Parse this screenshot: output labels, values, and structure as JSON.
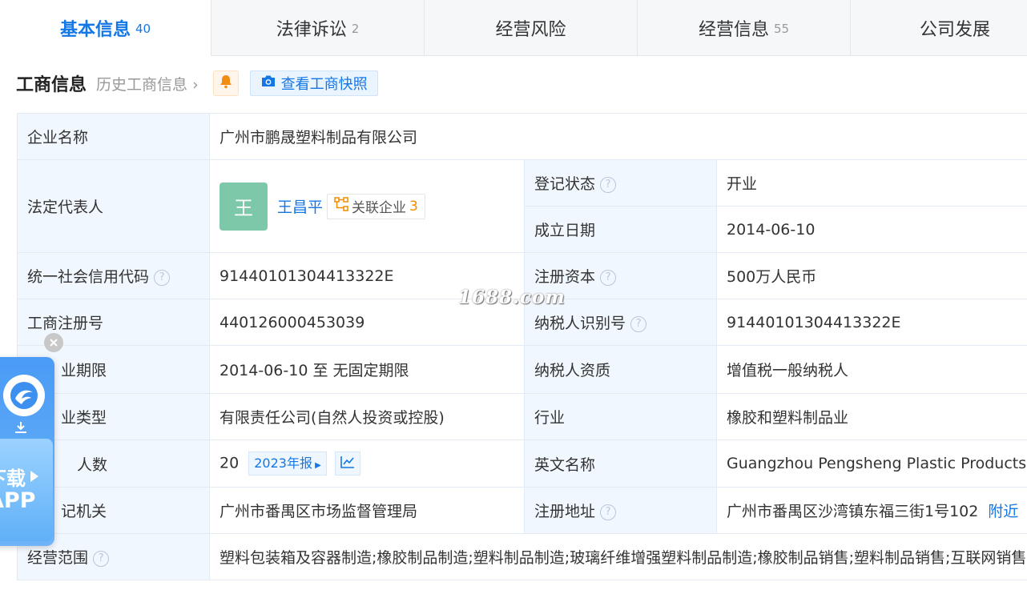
{
  "tabs": [
    {
      "label": "基本信息",
      "count": "40"
    },
    {
      "label": "法律诉讼",
      "count": "2"
    },
    {
      "label": "经营风险",
      "count": ""
    },
    {
      "label": "经营信息",
      "count": "55"
    },
    {
      "label": "公司发展",
      "count": ""
    }
  ],
  "section": {
    "title": "工商信息",
    "history_link": "历史工商信息",
    "snapshot_label": "查看工商快照"
  },
  "info": {
    "company_name_label": "企业名称",
    "company_name": "广州市鹏晟塑料制品有限公司",
    "legal_rep_label": "法定代表人",
    "legal_rep_avatar": "王",
    "legal_rep_name": "王昌平",
    "related_label": "关联企业",
    "related_count": "3",
    "reg_status_label": "登记状态",
    "reg_status": "开业",
    "est_date_label": "成立日期",
    "est_date": "2014-06-10",
    "credit_code_label": "统一社会信用代码",
    "credit_code": "91440101304413322E",
    "reg_capital_label": "注册资本",
    "reg_capital": "500万人民币",
    "reg_no_label": "工商注册号",
    "reg_no": "440126000453039",
    "taxpayer_id_label": "纳税人识别号",
    "taxpayer_id": "91440101304413322E",
    "term_label": "营业期限",
    "term_label_visible": "业期限",
    "term": "2014-06-10 至 无固定期限",
    "tax_qual_label": "纳税人资质",
    "tax_qual": "增值税一般纳税人",
    "type_label": "企业类型",
    "type_label_visible": "业类型",
    "type": "有限责任公司(自然人投资或控股)",
    "industry_label": "行业",
    "industry": "橡胶和塑料制品业",
    "insured_label": "参保人数",
    "insured_label_visible": "人数",
    "insured": "20",
    "report_label": "2023年报",
    "en_name_label": "英文名称",
    "en_name": "Guangzhou Pengsheng Plastic Products Co., Ltd.",
    "authority_label": "登记机关",
    "authority_label_visible": "记机关",
    "authority": "广州市番禺区市场监督管理局",
    "address_label": "注册地址",
    "address": "广州市番禺区沙湾镇东福三街1号102",
    "address_link": "附近",
    "scope_label": "经营范围",
    "scope": "塑料包装箱及容器制造;橡胶制品制造;塑料制品制造;玻璃纤维增强塑料制品制造;橡胶制品销售;塑料制品销售;互联网销售"
  },
  "watermark": "1688.com",
  "float_ad": {
    "line1": "下载",
    "line2": "APP"
  },
  "colors": {
    "accent": "#1477e6",
    "status_open": "#2f9e44",
    "key_bg": "#f1f7fe",
    "related_count": "#f08c00"
  },
  "icons": {
    "bell": "bell-icon",
    "camera": "camera-icon",
    "help": "question-circle-icon",
    "related": "network-icon",
    "chart": "line-chart-icon",
    "close": "close-icon",
    "download": "download-icon"
  }
}
